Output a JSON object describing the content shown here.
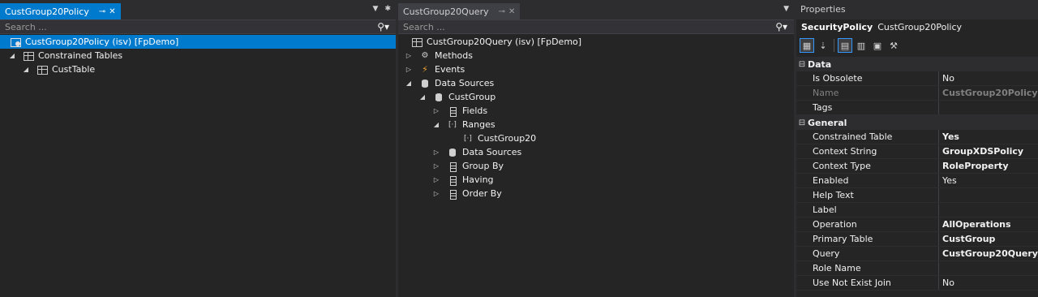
{
  "left": {
    "tab_title": "CustGroup20Policy",
    "search_placeholder": "Search ...",
    "items": [
      {
        "label": "CustGroup20Policy (isv) [FpDemo]"
      },
      {
        "label": "Constrained Tables"
      },
      {
        "label": "CustTable"
      }
    ]
  },
  "mid": {
    "tab_title": "CustGroup20Query",
    "search_placeholder": "Search ...",
    "items": [
      {
        "label": "CustGroup20Query (isv) [FpDemo]"
      },
      {
        "label": "Methods"
      },
      {
        "label": "Events"
      },
      {
        "label": "Data Sources"
      },
      {
        "label": "CustGroup"
      },
      {
        "label": "Fields"
      },
      {
        "label": "Ranges"
      },
      {
        "label": "CustGroup20"
      },
      {
        "label": "Data Sources"
      },
      {
        "label": "Group By"
      },
      {
        "label": "Having"
      },
      {
        "label": "Order By"
      }
    ]
  },
  "properties": {
    "title": "Properties",
    "object_type": "SecurityPolicy",
    "object_name": "CustGroup20Policy",
    "categories": [
      {
        "name": "Data",
        "rows": [
          {
            "name": "Is Obsolete",
            "value": "No"
          },
          {
            "name": "Name",
            "value": "CustGroup20Policy"
          },
          {
            "name": "Tags",
            "value": ""
          }
        ]
      },
      {
        "name": "General",
        "rows": [
          {
            "name": "Constrained Table",
            "value": "Yes"
          },
          {
            "name": "Context String",
            "value": "GroupXDSPolicy"
          },
          {
            "name": "Context Type",
            "value": "RoleProperty"
          },
          {
            "name": "Enabled",
            "value": "Yes"
          },
          {
            "name": "Help Text",
            "value": ""
          },
          {
            "name": "Label",
            "value": ""
          },
          {
            "name": "Operation",
            "value": "AllOperations"
          },
          {
            "name": "Primary Table",
            "value": "CustGroup"
          },
          {
            "name": "Query",
            "value": "CustGroup20Query"
          },
          {
            "name": "Role Name",
            "value": ""
          },
          {
            "name": "Use Not Exist Join",
            "value": "No"
          }
        ]
      }
    ]
  },
  "colors": {
    "accent": "#007acc",
    "background": "#252526",
    "chrome": "#2d2d30"
  }
}
